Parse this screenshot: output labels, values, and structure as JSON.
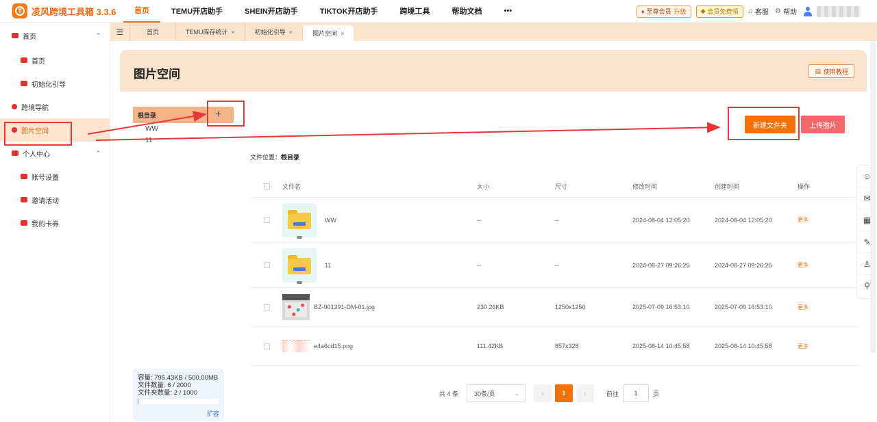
{
  "app": {
    "title": "凌风跨境工具箱 3.3.6",
    "logo_letter": "T"
  },
  "topnav": [
    {
      "label": "首页",
      "active": true
    },
    {
      "label": "TEMU开店助手",
      "active": false
    },
    {
      "label": "SHEIN开店助手",
      "active": false
    },
    {
      "label": "TIKTOK开店助手",
      "active": false
    },
    {
      "label": "跨境工具",
      "active": false
    },
    {
      "label": "帮助文档",
      "active": false
    },
    {
      "label": "•••",
      "active": false
    }
  ],
  "topright": {
    "vip_label": "至尊会员",
    "vip_upgrade": "升级",
    "free_member": "会员免费领",
    "service": "客服",
    "help": "帮助"
  },
  "sidebar": {
    "items": [
      {
        "label": "首页",
        "level": "top",
        "caret": "⌃"
      },
      {
        "label": "首页",
        "level": "sub"
      },
      {
        "label": "初始化引导",
        "level": "sub"
      },
      {
        "label": "跨境导航",
        "level": "top"
      },
      {
        "label": "图片空间",
        "level": "top",
        "active": true
      },
      {
        "label": "个人中心",
        "level": "top",
        "caret": "⌃"
      },
      {
        "label": "账号设置",
        "level": "sub"
      },
      {
        "label": "邀请活动",
        "level": "sub"
      },
      {
        "label": "我的卡券",
        "level": "sub"
      }
    ]
  },
  "tabs": [
    {
      "label": "首页",
      "closable": false
    },
    {
      "label": "TEMU库存统计",
      "closable": true
    },
    {
      "label": "初始化引导",
      "closable": true
    },
    {
      "label": "图片空间",
      "closable": true,
      "active": true
    }
  ],
  "page": {
    "title": "图片空间",
    "help_button": "使用教程",
    "root_folder": "根目录",
    "folders": [
      "WW",
      "11"
    ],
    "new_folder_button": "新建文件夹",
    "upload_button": "上传图片",
    "location_label": "文件位置：",
    "location_value": "根目录"
  },
  "table": {
    "headers": {
      "name": "文件名",
      "size": "大小",
      "dim": "尺寸",
      "modified": "修改时间",
      "created": "创建时间",
      "op": "操作"
    },
    "rows": [
      {
        "type": "folder",
        "name": "WW",
        "size": "--",
        "dim": "--",
        "modified": "2024-08-04 12:05:20",
        "created": "2024-08-04 12:05:20",
        "op": "更多"
      },
      {
        "type": "folder",
        "name": "11",
        "size": "--",
        "dim": "--",
        "modified": "2024-08-27 09:26:25",
        "created": "2024-08-27 09:26:25",
        "op": "更多"
      },
      {
        "type": "image",
        "name": "BZ-901291-DM-01.jpg",
        "size": "230.26KB",
        "dim": "1250x1250",
        "modified": "2025-07-09 16:53:10",
        "created": "2025-07-09 16:53:10",
        "op": "更多"
      },
      {
        "type": "image2",
        "name": "e4a6cd15.png",
        "size": "111.42KB",
        "dim": "857x328",
        "modified": "2025-08-14 10:45:58",
        "created": "2025-08-14 10:45:58",
        "op": "更多"
      }
    ]
  },
  "pager": {
    "total": "共 4 条",
    "page_size": "30条/页",
    "current": "1",
    "goto_prefix": "前往",
    "goto_value": "1",
    "goto_suffix": "页"
  },
  "quota": {
    "capacity": "容量:  795.43KB / 500.00MB",
    "file_count": "文件数量:  6 / 2000",
    "folder_count": "文件夹数量:  2 / 1000",
    "expand": "扩容",
    "used_fraction": 0.0016
  },
  "colors": {
    "accent": "#f27109",
    "annotation": "#e8363a"
  }
}
